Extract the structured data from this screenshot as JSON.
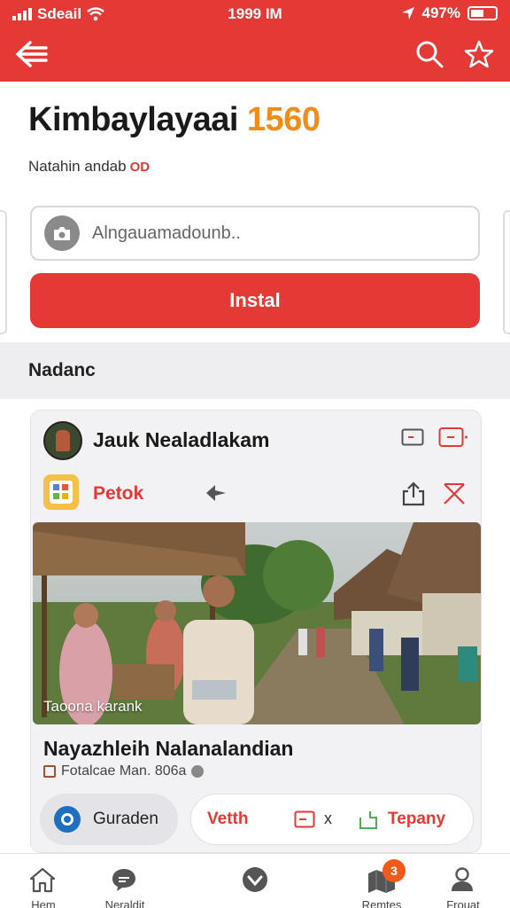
{
  "status_bar": {
    "carrier": "Sdeail",
    "time": "1999 IM",
    "battery": "497%"
  },
  "header": {
    "title": "Kimbaylayaai",
    "title_number": "1560",
    "subtitle": "Natahin andab",
    "subtitle_tag": "OD"
  },
  "search": {
    "placeholder": "Alngauamadounb.."
  },
  "install_button": "Instal",
  "section_title": "Nadanc",
  "card": {
    "author_name": "Jauk Nealadlakam",
    "app_name": "Petok",
    "photo_caption": "Taoona karank",
    "post_title": "Nayazhleih Nalanalandian",
    "post_meta": "Fotalcae Man. 806a",
    "action_left": "Guraden",
    "action_vetth": "Vetth",
    "action_x": "x",
    "action_tepany": "Tepany"
  },
  "bottom_nav": [
    {
      "label": "Hem",
      "icon": "home-icon"
    },
    {
      "label": "Neraldit",
      "icon": "chat-icon"
    },
    {
      "label": "",
      "icon": "heart-icon"
    },
    {
      "label": "Remtes",
      "icon": "map-icon",
      "badge": "3"
    },
    {
      "label": "Frouat",
      "icon": "profile-icon"
    }
  ],
  "colors": {
    "accent": "#e53935",
    "number": "#f08c1a",
    "badge": "#f05a1a"
  }
}
